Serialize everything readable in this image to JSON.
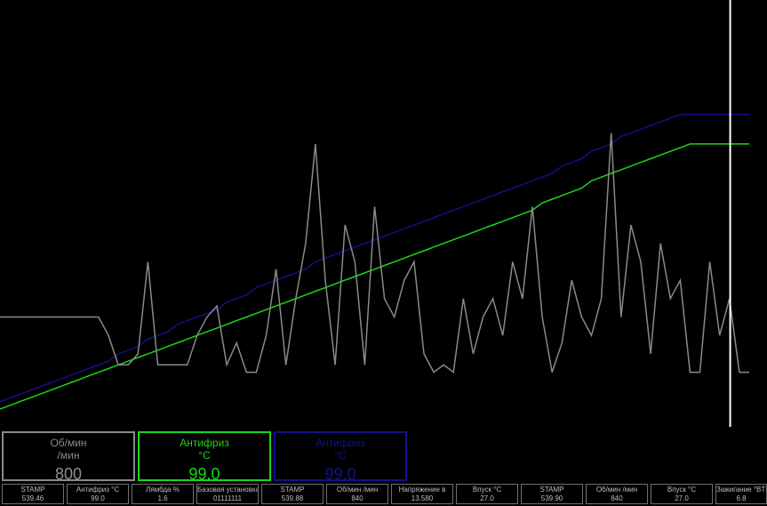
{
  "colors": {
    "rpm": "#8a8a8a",
    "coolant": "#19d719",
    "coolant2": "#121288",
    "cursor": "#ffffff",
    "background": "#000000"
  },
  "chart_data": {
    "type": "line",
    "series": [
      {
        "values": [
          0.02,
          0.03,
          0.04,
          0.05,
          0.06,
          0.07,
          0.08,
          0.09,
          0.1,
          0.11,
          0.12,
          0.13,
          0.15,
          0.16,
          0.17,
          0.19,
          0.2,
          0.21,
          0.23,
          0.24,
          0.25,
          0.26,
          0.27,
          0.29,
          0.3,
          0.31,
          0.33,
          0.34,
          0.35,
          0.36,
          0.37,
          0.38,
          0.4,
          0.41,
          0.42,
          0.43,
          0.44,
          0.45,
          0.46,
          0.47,
          0.48,
          0.49,
          0.5,
          0.51,
          0.52,
          0.53,
          0.54,
          0.55,
          0.56,
          0.57,
          0.58,
          0.59,
          0.6,
          0.61,
          0.62,
          0.63,
          0.64,
          0.66,
          0.67,
          0.68,
          0.7,
          0.71,
          0.72,
          0.74,
          0.75,
          0.76,
          0.77,
          0.78,
          0.79,
          0.8,
          0.8,
          0.8,
          0.8,
          0.8,
          0.8,
          0.8,
          0.8
        ]
      },
      {
        "values": [
          0.0,
          0.01,
          0.02,
          0.03,
          0.04,
          0.05,
          0.06,
          0.07,
          0.08,
          0.09,
          0.1,
          0.11,
          0.12,
          0.13,
          0.14,
          0.15,
          0.16,
          0.17,
          0.18,
          0.19,
          0.2,
          0.21,
          0.22,
          0.23,
          0.24,
          0.25,
          0.26,
          0.27,
          0.28,
          0.29,
          0.3,
          0.31,
          0.32,
          0.33,
          0.34,
          0.35,
          0.36,
          0.37,
          0.38,
          0.39,
          0.4,
          0.41,
          0.42,
          0.43,
          0.44,
          0.45,
          0.46,
          0.47,
          0.48,
          0.49,
          0.5,
          0.51,
          0.52,
          0.53,
          0.54,
          0.56,
          0.57,
          0.58,
          0.59,
          0.6,
          0.62,
          0.63,
          0.64,
          0.65,
          0.66,
          0.67,
          0.68,
          0.69,
          0.7,
          0.71,
          0.72,
          0.72,
          0.72,
          0.72,
          0.72,
          0.72,
          0.72
        ]
      },
      {
        "values": [
          0.25,
          0.25,
          0.25,
          0.25,
          0.25,
          0.25,
          0.25,
          0.25,
          0.25,
          0.25,
          0.25,
          0.2,
          0.12,
          0.12,
          0.15,
          0.4,
          0.12,
          0.12,
          0.12,
          0.12,
          0.2,
          0.25,
          0.28,
          0.12,
          0.18,
          0.1,
          0.1,
          0.2,
          0.38,
          0.12,
          0.3,
          0.45,
          0.72,
          0.35,
          0.12,
          0.5,
          0.4,
          0.12,
          0.55,
          0.3,
          0.25,
          0.35,
          0.4,
          0.15,
          0.1,
          0.12,
          0.1,
          0.3,
          0.15,
          0.25,
          0.3,
          0.2,
          0.4,
          0.3,
          0.55,
          0.25,
          0.1,
          0.18,
          0.35,
          0.25,
          0.2,
          0.3,
          0.75,
          0.25,
          0.5,
          0.4,
          0.15,
          0.45,
          0.3,
          0.35,
          0.1,
          0.1,
          0.4,
          0.2,
          0.3,
          0.1,
          0.1
        ]
      }
    ],
    "cursor_x": 0.952
  },
  "panels": {
    "rpm": {
      "label": "Об/мин",
      "unit": "/мин",
      "value": "800"
    },
    "coolant": {
      "label": "Антифриз",
      "unit": "°C",
      "value": "99.0"
    },
    "coolant2": {
      "label": "Антифриз",
      "unit": "°C",
      "value": "99.0"
    }
  },
  "status": [
    {
      "label": "STAMP",
      "value": "539.46"
    },
    {
      "label": "Антифриз °C",
      "value": "99.0"
    },
    {
      "label": "Лямбда %",
      "value": "1.6"
    },
    {
      "label": "Базовая установка",
      "value": "01111111"
    },
    {
      "label": "STAMP",
      "value": "539.88"
    },
    {
      "label": "Об/мин /мин",
      "value": "840"
    },
    {
      "label": "Напряжение в",
      "value": "13.580"
    },
    {
      "label": "Впуск °C",
      "value": "27.0"
    },
    {
      "label": "STAMP",
      "value": "539.90"
    },
    {
      "label": "Об/мин /мин",
      "value": "840"
    },
    {
      "label": "Впуск °C",
      "value": "27.0"
    },
    {
      "label": "Зажигание °BTDC",
      "value": "6.8"
    }
  ]
}
